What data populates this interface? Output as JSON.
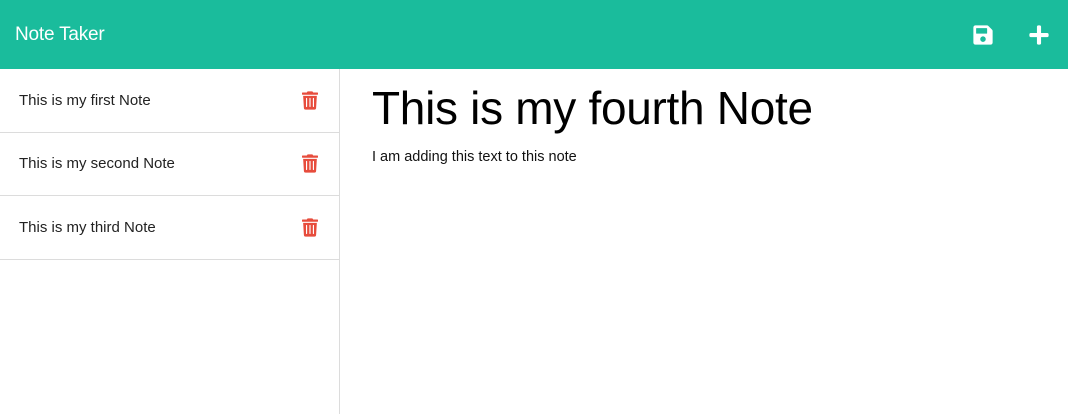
{
  "app": {
    "brand": "Note Taker"
  },
  "navbar": {
    "save_icon": "save-icon",
    "new_icon": "plus-icon",
    "background_color": "#1abc9c"
  },
  "sidebar": {
    "notes": [
      {
        "title": "This is my first Note",
        "delete_icon": "trash-icon"
      },
      {
        "title": "This is my second Note",
        "delete_icon": "trash-icon"
      },
      {
        "title": "This is my third Note",
        "delete_icon": "trash-icon"
      }
    ],
    "delete_color": "#e74c3c"
  },
  "editor": {
    "title_value": "This is my fourth Note",
    "text_value": "I am adding this text to this note"
  }
}
